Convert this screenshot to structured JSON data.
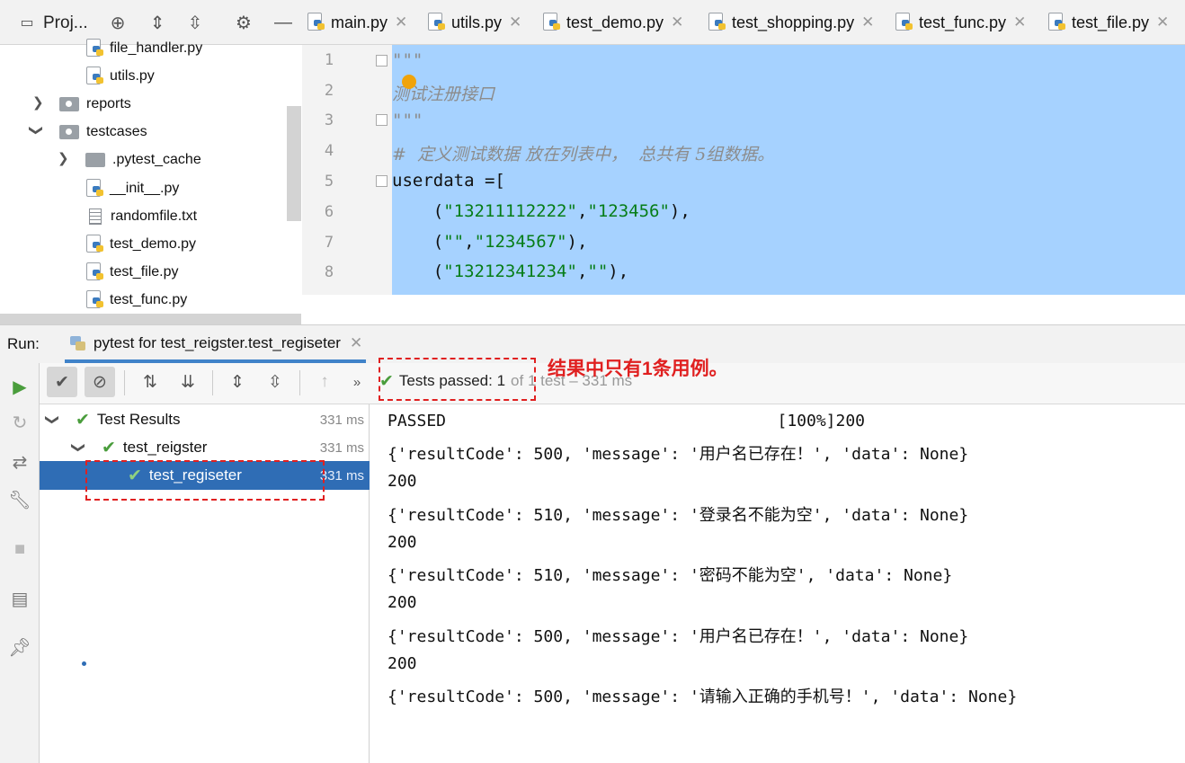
{
  "project": {
    "title": "Proj..."
  },
  "tabs": [
    {
      "label": "main.py"
    },
    {
      "label": "utils.py"
    },
    {
      "label": "test_demo.py"
    },
    {
      "label": "test_shopping.py"
    },
    {
      "label": "test_func.py"
    },
    {
      "label": "test_file.py"
    }
  ],
  "tree": {
    "items": [
      {
        "label": "file_handler.py"
      },
      {
        "label": "utils.py"
      },
      {
        "label": "reports"
      },
      {
        "label": "testcases"
      },
      {
        "label": ".pytest_cache"
      },
      {
        "label": "__init__.py"
      },
      {
        "label": "randomfile.txt"
      },
      {
        "label": "test_demo.py"
      },
      {
        "label": "test_file.py"
      },
      {
        "label": "test_func.py"
      }
    ]
  },
  "editor": {
    "line_numbers": [
      "1",
      "2",
      "3",
      "4",
      "5",
      "6",
      "7",
      "8"
    ],
    "lines": [
      {
        "text": "\"\"\""
      },
      {
        "text": "测试注册接口"
      },
      {
        "text": "\"\"\""
      },
      {
        "text": "#  定义测试数据 放在列表中，  总共有 5组数据。"
      },
      {
        "text": "userdata =["
      },
      {
        "indent": "    ",
        "open": "(",
        "s1": "\"13211112222\"",
        "comma": ",",
        "s2": "\"123456\"",
        "close": "),"
      },
      {
        "indent": "    ",
        "open": "(",
        "s1": "\"\"",
        "comma": ",",
        "s2": "\"1234567\"",
        "close": "),"
      },
      {
        "indent": "    ",
        "open": "(",
        "s1": "\"13212341234\"",
        "comma": ",",
        "s2": "\"\"",
        "close": "),"
      }
    ]
  },
  "run": {
    "label": "Run:",
    "tab_label": "pytest for test_reigster.test_regiseter",
    "status_text": "Tests passed: 1",
    "status_sub": "of 1 test – 331 ms",
    "annotation": "结果中只有1条用例。"
  },
  "results": [
    {
      "label": "Test Results",
      "time": "331 ms"
    },
    {
      "label": "test_reigster",
      "time": "331 ms"
    },
    {
      "label": "test_regiseter",
      "time": "331 ms"
    }
  ],
  "console": [
    "PASSED                                  [100%]200",
    "{'resultCode': 500, 'message': '用户名已存在！', 'data': None}",
    "200",
    "{'resultCode': 510, 'message': '登录名不能为空', 'data': None}",
    "200",
    "{'resultCode': 510, 'message': '密码不能为空', 'data': None}",
    "200",
    "{'resultCode': 500, 'message': '用户名已存在！', 'data': None}",
    "200",
    "{'resultCode': 500, 'message': '请输入正确的手机号！', 'data': None}"
  ],
  "colors": {
    "accent": "#2f6db5",
    "selection": "#a6d2ff",
    "pass": "#4a9d3c",
    "annotation": "#e02020"
  }
}
